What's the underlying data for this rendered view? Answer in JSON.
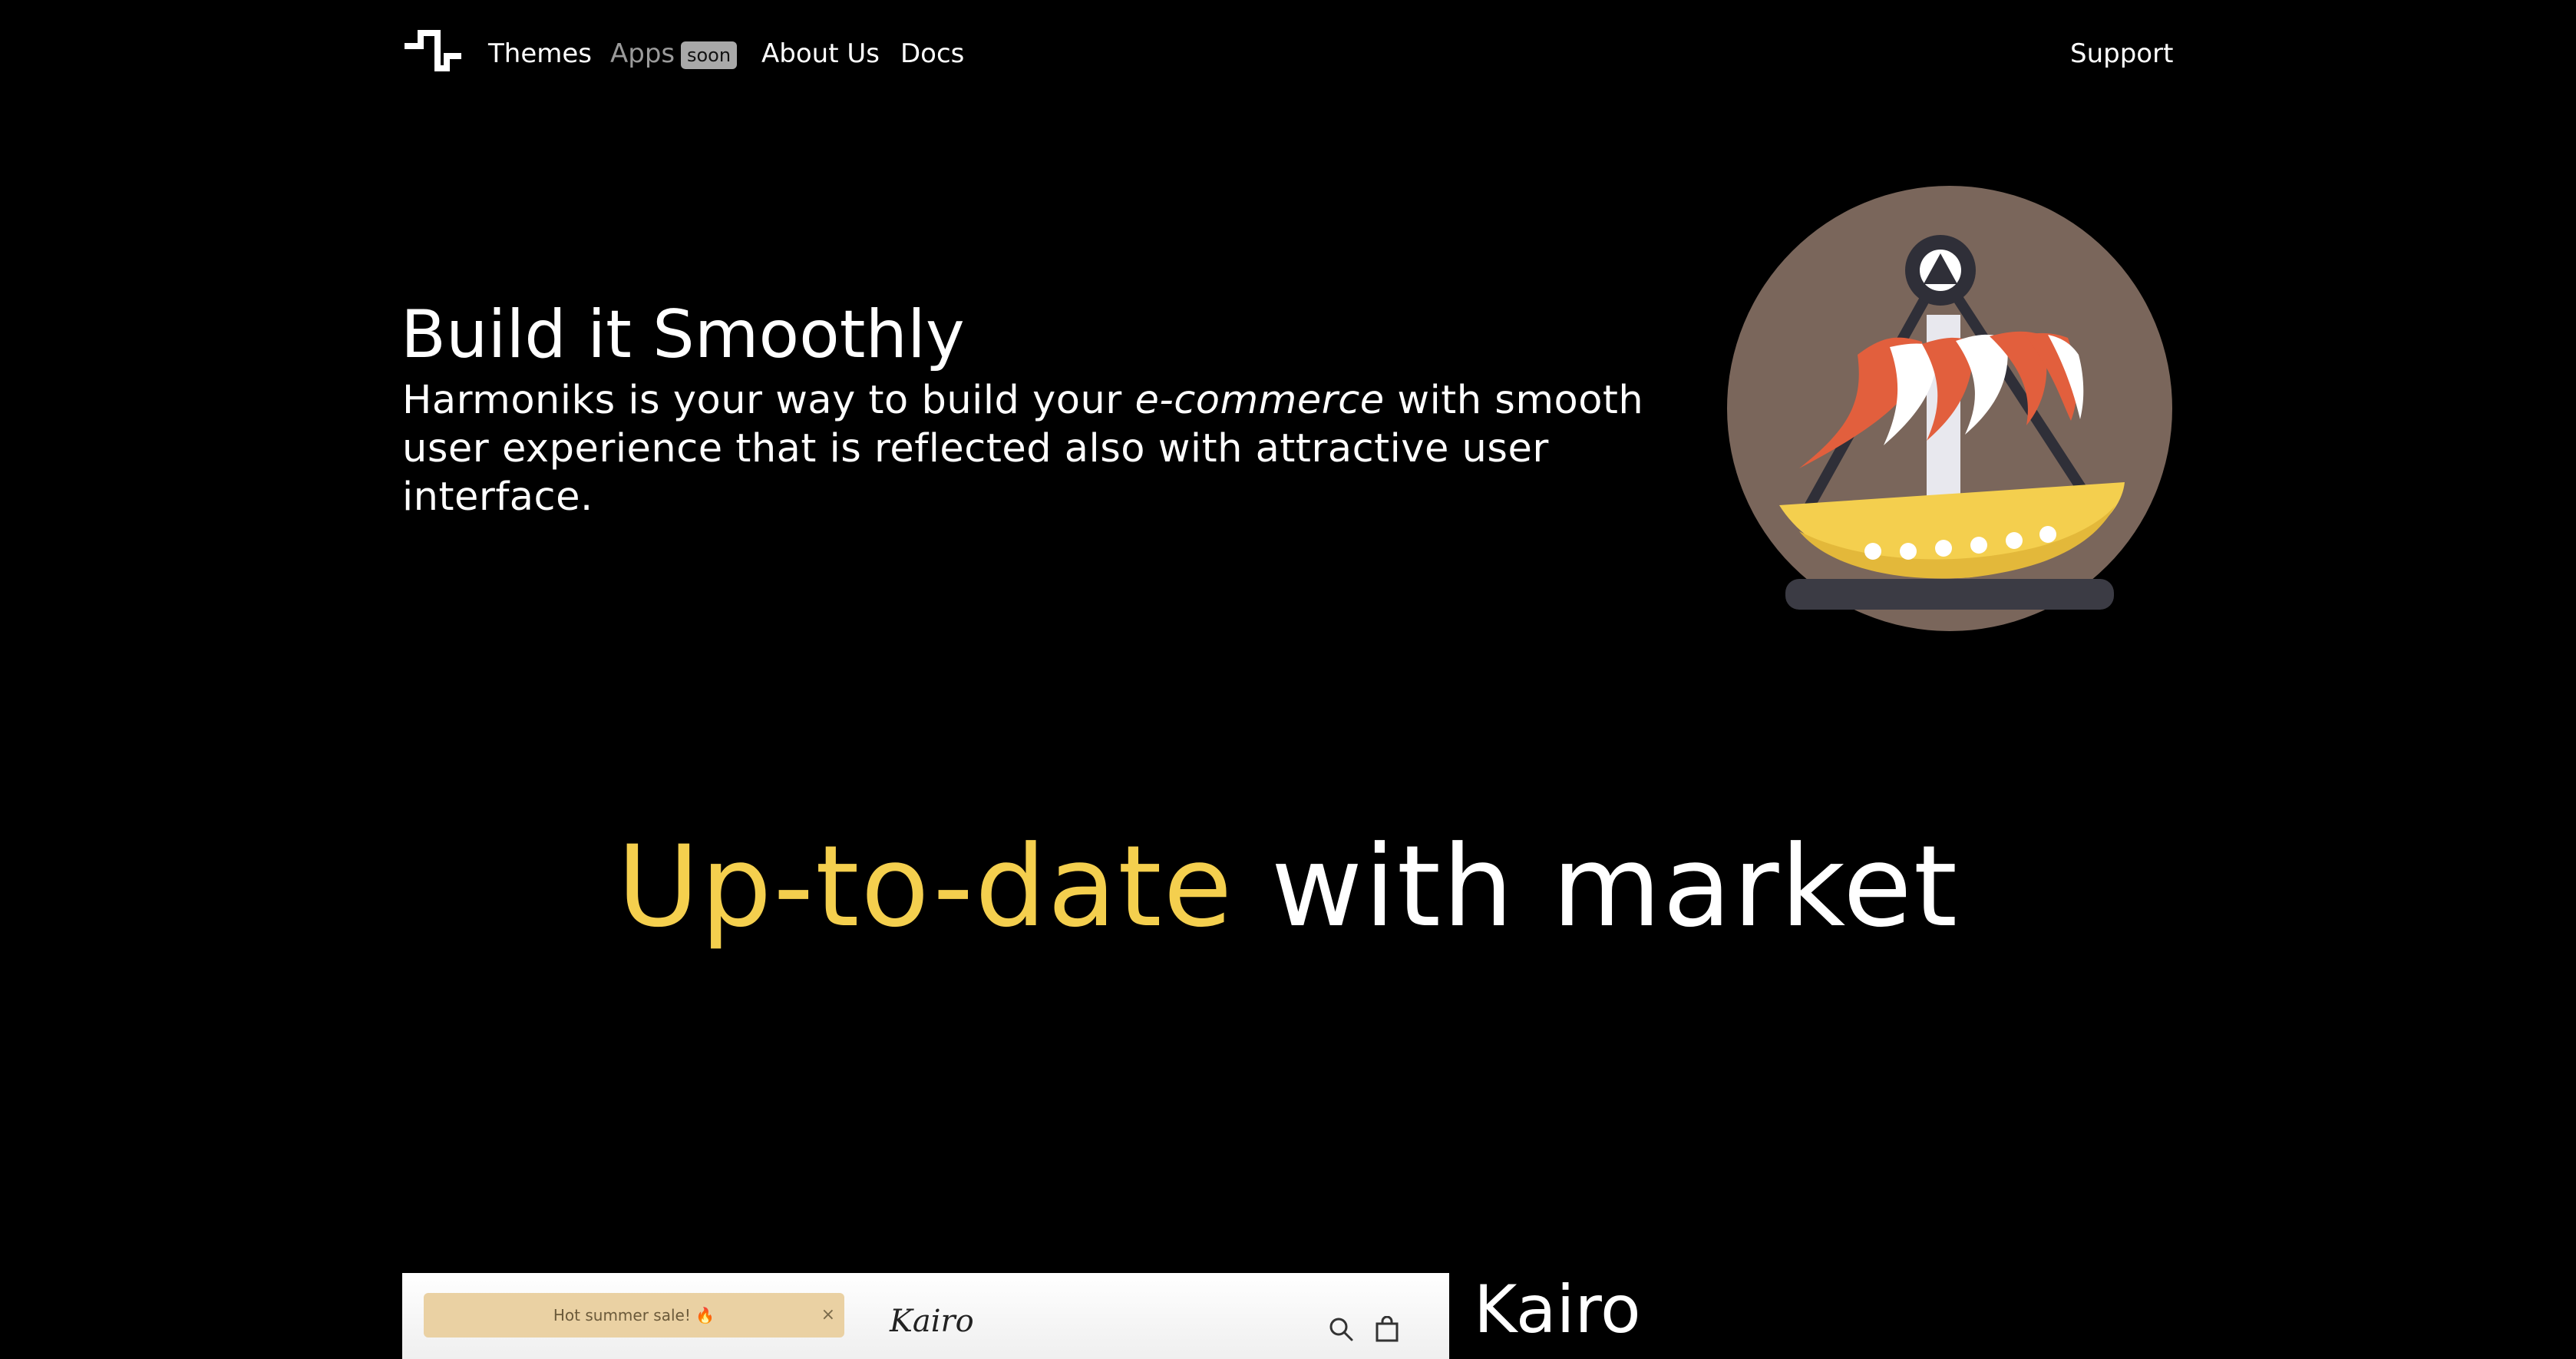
{
  "nav": {
    "logo_icon": "harmoniks-wave-logo",
    "links": {
      "themes": "Themes",
      "apps": "Apps",
      "apps_badge": "soon",
      "about": "About Us",
      "docs": "Docs",
      "support": "Support"
    }
  },
  "hero": {
    "title": "Build it Smoothly",
    "desc_before": "Harmoniks is your way to build your ",
    "desc_em": "e-commerce",
    "desc_after": " with smooth user experience that is reflected also with attractive user interface.",
    "illustration_icon": "pirate-ship-ride-icon"
  },
  "tagline": {
    "highlight": "Up-to-date",
    "rest": " with market",
    "highlight_color": "#f4cf4e"
  },
  "theme_preview": {
    "sale_text": "Hot summer sale! 🔥",
    "close_glyph": "×",
    "brand": "Kairo",
    "icons": [
      "search-icon",
      "shopping-bag-icon"
    ]
  },
  "theme": {
    "name": "Kairo"
  },
  "colors": {
    "background": "#000000",
    "text": "#ffffff",
    "accent": "#f4cf4e",
    "muted": "#9a9a9a"
  }
}
